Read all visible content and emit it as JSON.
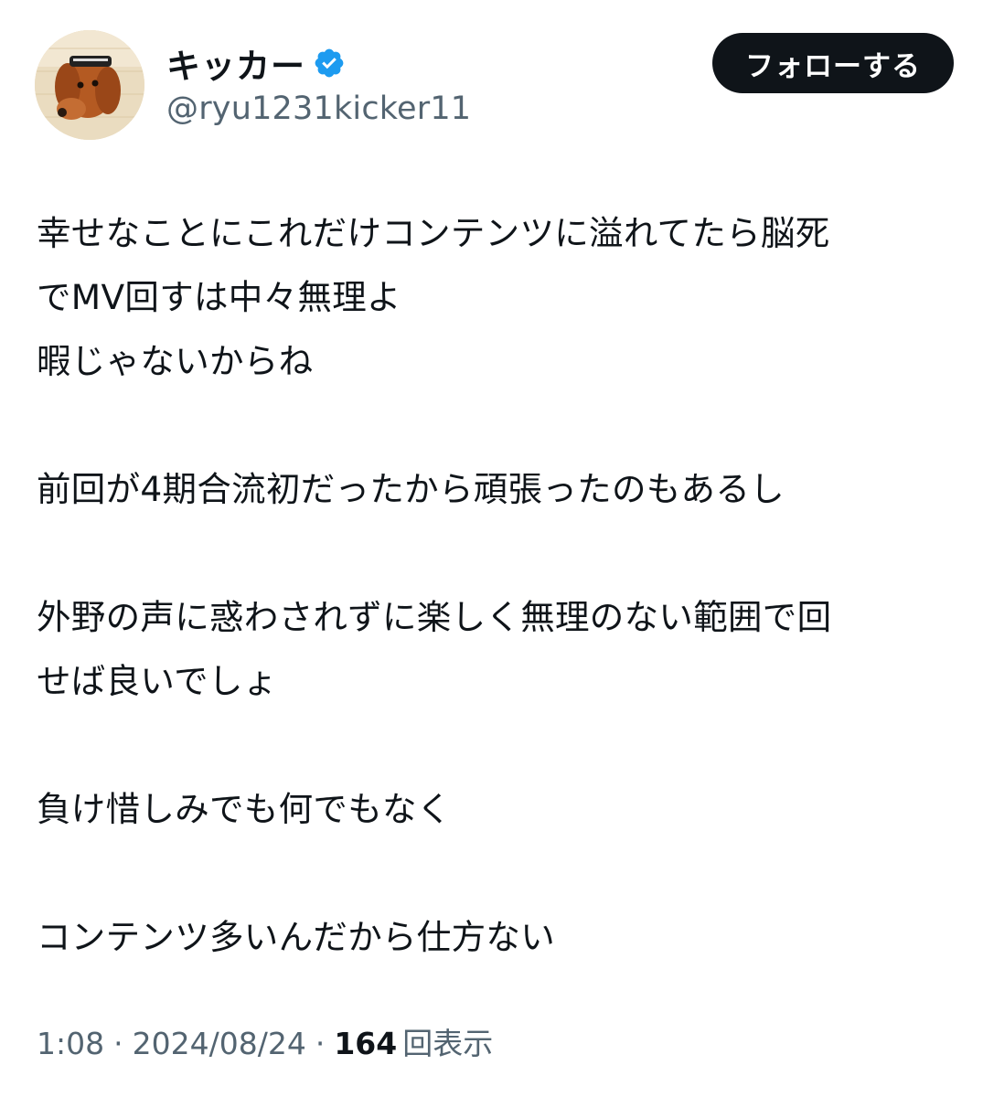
{
  "profile": {
    "display_name": "キッカー",
    "handle": "@ryu1231kicker11",
    "verified_icon": "verified-badge-icon",
    "avatar": "dog-photo-avatar"
  },
  "follow_button": {
    "label": "フォローする"
  },
  "tweet": {
    "paragraphs": [
      [
        "幸せなことにこれだけコンテンツに溢れてたら脳死",
        "でMV回すは中々無理よ",
        "暇じゃないからね"
      ],
      [
        "前回が4期合流初だったから頑張ったのもあるし"
      ],
      [
        "外野の声に惑わされずに楽しく無理のない範囲で回",
        "せば良いでしょ"
      ],
      [
        "負け惜しみでも何でもなく"
      ],
      [
        "コンテンツ多いんだから仕方ない"
      ]
    ]
  },
  "meta": {
    "time": "1:08",
    "separator": "·",
    "date": "2024/08/24",
    "views_count": "164",
    "views_label": "回表示"
  },
  "colors": {
    "text_primary": "#0f1419",
    "text_secondary": "#536471",
    "verified_blue": "#1d9bf0",
    "button_bg": "#0f1419"
  }
}
